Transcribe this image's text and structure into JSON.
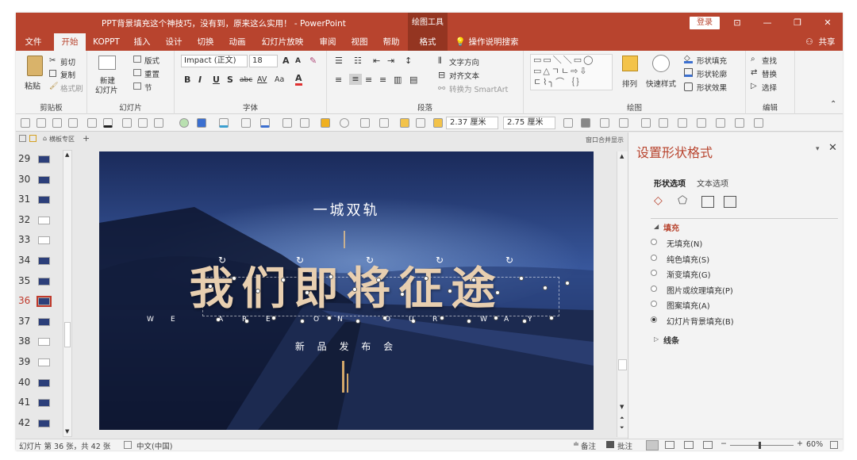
{
  "titlebar": {
    "title": "PPT背景填充这个神技巧，没有到，原来这么实用！ - PowerPoint",
    "context": "绘图工具",
    "login": "登录",
    "controls": [
      "⊡",
      "—",
      "❐",
      "✕"
    ]
  },
  "tabs": {
    "items": [
      "文件",
      "开始",
      "KOPPT",
      "插入",
      "设计",
      "切换",
      "动画",
      "幻灯片放映",
      "审阅",
      "视图",
      "帮助",
      "格式"
    ],
    "tell_me": "操作说明搜索",
    "share": "共享"
  },
  "ribbon": {
    "clipboard": {
      "label": "剪贴板",
      "paste": "粘贴",
      "cut": "剪切",
      "copy": "复制",
      "painter": "格式刷"
    },
    "slides": {
      "label": "幻灯片",
      "new": "新建",
      "new2": "幻灯片",
      "layout": "版式",
      "reset": "重置",
      "section": "节"
    },
    "font": {
      "label": "字体",
      "name": "Impact (正文)",
      "size": "18",
      "grow": "A",
      "shrink": "A",
      "aa": "Aa",
      "bold": "B",
      "italic": "I",
      "underline": "U",
      "strike": "S",
      "abc": "abc",
      "av": "AV",
      "fontcolor": "A"
    },
    "paragraph": {
      "label": "段落",
      "textdir": "文字方向",
      "align": "对齐文本",
      "smartart": "转换为 SmartArt"
    },
    "drawing": {
      "label": "绘图",
      "arrange": "排列",
      "styles": "快速样式",
      "fill": "形状填充",
      "outline": "形状轮廓",
      "effects": "形状效果"
    },
    "editing": {
      "label": "编辑",
      "find": "查找",
      "replace": "替换",
      "select": "选择"
    }
  },
  "quickbar": {
    "width": "2.37 厘米",
    "height": "2.75 厘米"
  },
  "leftpanel": {
    "tab1": "横板专区",
    "slides": [
      {
        "n": "29"
      },
      {
        "n": "30"
      },
      {
        "n": "31"
      },
      {
        "n": "32"
      },
      {
        "n": "33"
      },
      {
        "n": "34"
      },
      {
        "n": "35"
      },
      {
        "n": "36"
      },
      {
        "n": "37"
      },
      {
        "n": "38"
      },
      {
        "n": "39"
      },
      {
        "n": "40"
      },
      {
        "n": "41"
      },
      {
        "n": "42"
      }
    ],
    "current": "36"
  },
  "slide": {
    "top_text": "一城双轨",
    "headline": "我们即将征途",
    "subtitle_letters": [
      "W",
      "E",
      "A",
      "R",
      "E",
      "O",
      "N",
      "O",
      "U",
      "R",
      "W",
      "A",
      "Y"
    ],
    "release": "新 品 发 布 会",
    "window_label": "窗口合并显示"
  },
  "pane": {
    "title": "设置形状格式",
    "tab1": "形状选项",
    "tab2": "文本选项",
    "section_fill": "填充",
    "options": [
      "无填充(N)",
      "纯色填充(S)",
      "渐变填充(G)",
      "图片或纹理填充(P)",
      "图案填充(A)",
      "幻灯片背景填充(B)"
    ],
    "selected": 5,
    "section_line": "线条"
  },
  "status": {
    "slide_info": "幻灯片 第 36 张，共 42 张",
    "lang": "中文(中国)",
    "notes": "备注",
    "comments": "批注",
    "zoom": "60%"
  },
  "colors": {
    "accent": "#b8442e",
    "accent_dark": "#943521",
    "slide_bg": "#203262",
    "headline": "#e8cfb0"
  }
}
